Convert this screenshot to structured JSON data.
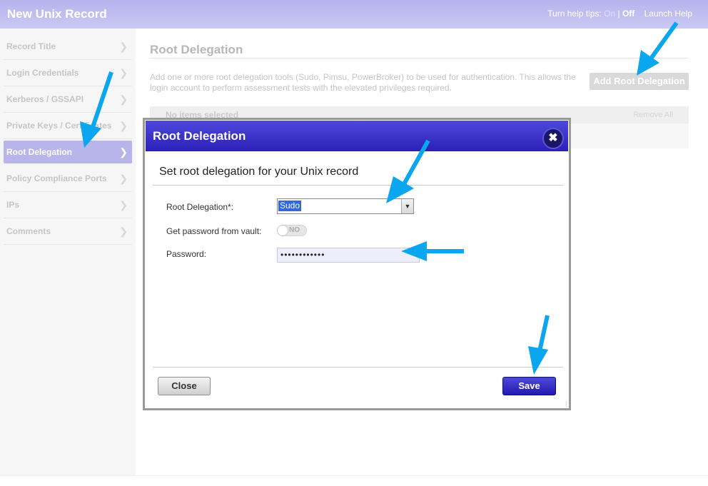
{
  "header": {
    "title": "New Unix Record",
    "help_tips_label": "Turn help tips:",
    "help_on": "On",
    "help_sep": "|",
    "help_off": "Off",
    "launch_help": "Launch Help"
  },
  "sidebar": {
    "items": [
      {
        "label": "Record Title"
      },
      {
        "label": "Login Credentials"
      },
      {
        "label": "Kerberos / GSSAPI"
      },
      {
        "label": "Private Keys / Certificates"
      },
      {
        "label": "Root Delegation",
        "active": true
      },
      {
        "label": "Policy Compliance Ports"
      },
      {
        "label": "IPs"
      },
      {
        "label": "Comments"
      }
    ]
  },
  "main": {
    "title": "Root Delegation",
    "description": "Add one or more root delegation tools (Sudo, Pimsu, PowerBroker) to be used for authentication. This allows the login account to perform assessment tests with the elevated privileges required.",
    "add_button": "Add Root Delegation",
    "no_items": "No items selected",
    "remove_all": "Remove All"
  },
  "dialog": {
    "title": "Root Delegation",
    "close_glyph": "✖",
    "subtitle": "Set root delegation for your Unix record",
    "fields": {
      "root_delegation_label": "Root Delegation*:",
      "root_delegation_value": "Sudo",
      "vault_label": "Get password from vault:",
      "vault_toggle": "NO",
      "password_label": "Password:",
      "password_value": "••••••••••••"
    },
    "close_button": "Close",
    "save_button": "Save"
  },
  "icons": {
    "chevron": "chevron-right-icon",
    "dropdown": "dropdown-arrow-icon",
    "annotation": "arrow-annotation"
  },
  "colors": {
    "header_bg": "#c0bef0",
    "dialog_header": "#3a32c8",
    "active_nav": "#b8b5ea",
    "annotation_arrow": "#0aa6ef"
  }
}
